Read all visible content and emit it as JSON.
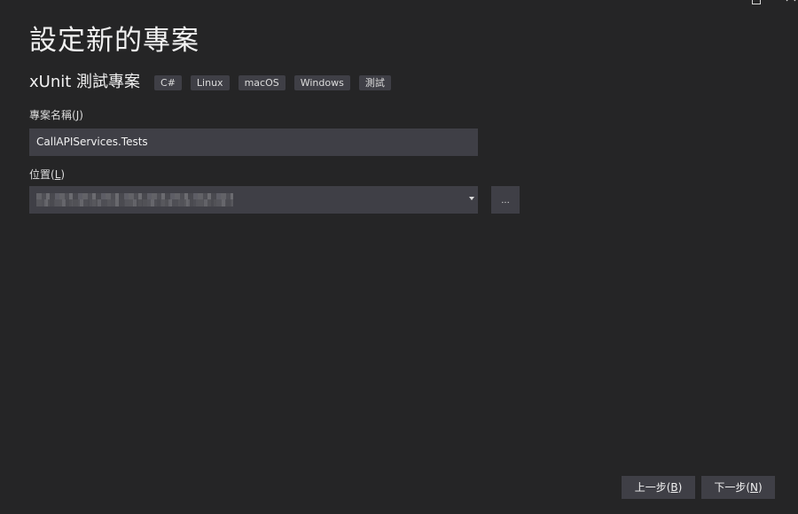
{
  "window": {
    "title": "設定新的專案",
    "controls": {
      "maximize_icon": "maximize-icon",
      "close_icon": "close-icon"
    }
  },
  "template": {
    "name": "xUnit 測試專案",
    "tags": [
      "C#",
      "Linux",
      "macOS",
      "Windows",
      "測試"
    ]
  },
  "project_name": {
    "label": "專案名稱",
    "accelerator": "J",
    "value": "CallAPIServices.Tests"
  },
  "location": {
    "label": "位置",
    "accelerator": "L",
    "browse_label": "..."
  },
  "footer": {
    "back": {
      "label": "上一步",
      "accelerator": "B"
    },
    "next": {
      "label": "下一步",
      "accelerator": "N"
    }
  },
  "colors": {
    "background": "#252526",
    "control": "#3f3f46",
    "text": "#f1f1f1"
  }
}
